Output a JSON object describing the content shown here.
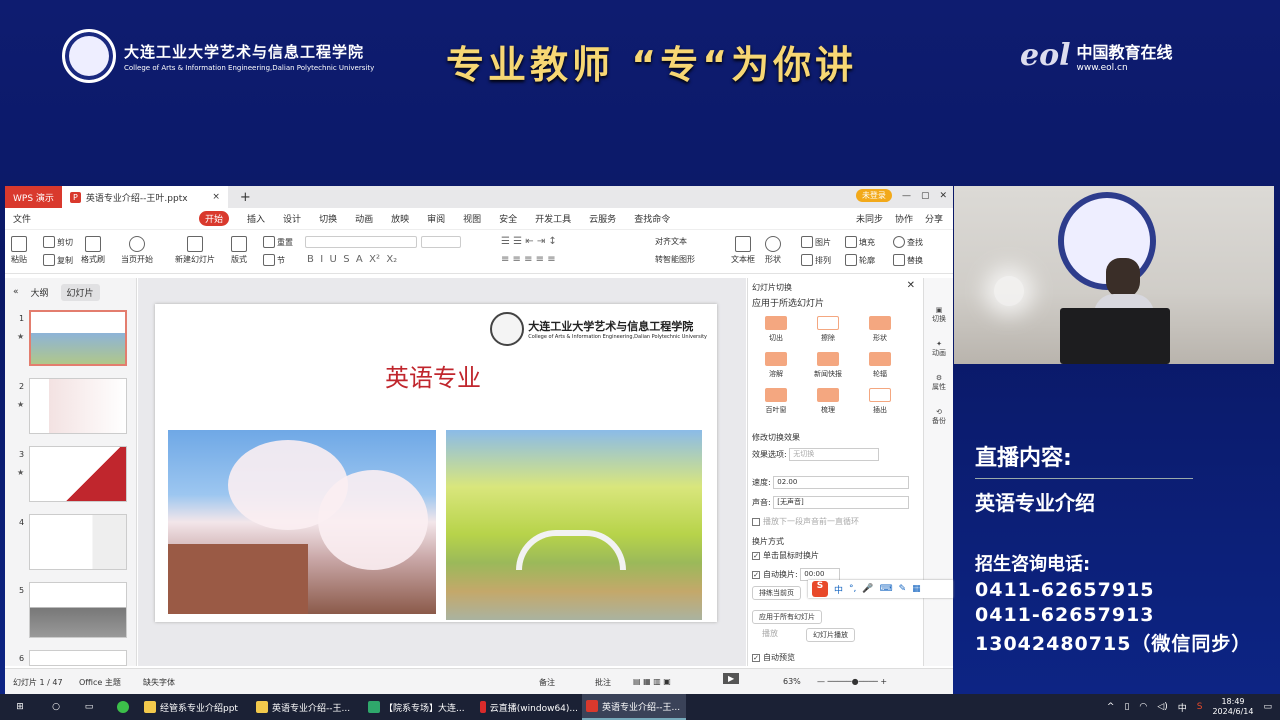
{
  "banner": {
    "college_cn": "大连工业大学艺术与信息工程学院",
    "college_en": "College of Arts & Information Engineering,Dalian Polytechnic University",
    "title": "专业教师 “专“为你讲",
    "eol_mark": "eol",
    "eol_cn": "中国教育在线",
    "eol_url": "www.eol.cn"
  },
  "app": {
    "app_tab": "WPS 演示",
    "doc_tab": "英语专业介绍--王叶.pptx",
    "login": "未登录",
    "menu": [
      "文件",
      "开始",
      "插入",
      "设计",
      "切换",
      "动画",
      "放映",
      "审阅",
      "视图",
      "安全",
      "开发工具",
      "云服务",
      "查找命令"
    ],
    "menu_right": [
      "未同步",
      "协作",
      "分享"
    ],
    "ribbon": {
      "paste": "粘贴",
      "cut": "剪切",
      "copy": "复制",
      "format_painter": "格式刷",
      "from_current": "当页开始",
      "new_slide": "新建幻灯片",
      "layout": "版式",
      "reset": "重置",
      "section": "节",
      "text_box": "文本框",
      "shape": "形状",
      "arrange": "排列",
      "picture": "图片",
      "fill": "填充",
      "outline": "轮廓",
      "find": "查找",
      "replace": "替换",
      "align_text": "对齐文本",
      "convert": "转智能图形"
    },
    "left_tabs": [
      "大纲",
      "幻灯片"
    ],
    "slide_numbers": [
      "1",
      "2",
      "3",
      "4",
      "5",
      "6"
    ],
    "slide": {
      "title": "英语专业",
      "college_cn": "大连工业大学艺术与信息工程学院",
      "college_en": "College of Arts & Information Engineering,Dalian Polytechnic University"
    },
    "transition_panel": {
      "header": "幻灯片切换",
      "apply_to": "应用于所选幻灯片",
      "effects": [
        "切出",
        "擦除",
        "形状",
        "溶解",
        "新闻快报",
        "轮辐",
        "百叶窗",
        "梳理",
        "插出"
      ],
      "modify": "修改切换效果",
      "effect_option_label": "效果选项:",
      "effect_option_value": "无切换",
      "speed_label": "速度:",
      "speed_value": "02.00",
      "sound_label": "声音:",
      "sound_value": "[无声音]",
      "loop": "播放下一段声音前一直循环",
      "advance": "换片方式",
      "on_click": "单击鼠标时换片",
      "auto": "自动换片:",
      "auto_value": "00:00",
      "apply_current": "排练当前页",
      "apply_all": "应用于所有幻灯片",
      "play": "播放",
      "slideshow": "幻灯片播放",
      "autopreview": "自动预览"
    },
    "side_icons": [
      "切换",
      "动画",
      "属性",
      "备份"
    ],
    "status": {
      "slide_count": "幻灯片 1 / 47",
      "theme": "Office 主题",
      "missing_font": "缺失字体",
      "notes": "备注",
      "comments": "批注",
      "zoom": "63%"
    }
  },
  "ime": {
    "logo": "S",
    "mode": "中"
  },
  "live": {
    "heading": "直播内容:",
    "topic": "英语专业介绍",
    "consult": "招生咨询电话:",
    "phones": [
      "0411-62657915",
      "0411-62657913",
      "13042480715（微信同步）"
    ]
  },
  "taskbar": {
    "items": [
      "经管系专业介绍ppt",
      "英语专业介绍--王...",
      "【院系专场】大连...",
      "云直播(window64)...",
      "英语专业介绍--王..."
    ],
    "tray_lang": "中",
    "time": "18:49",
    "date": "2024/6/14"
  }
}
